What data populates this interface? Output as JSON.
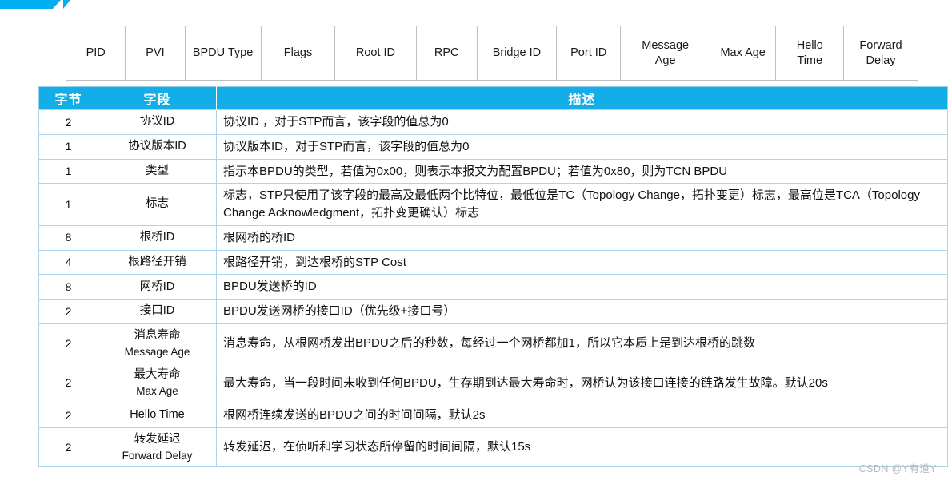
{
  "banner": {
    "accent_color": "#00AEEF"
  },
  "format_table": {
    "name": "BPDU frame format strip",
    "cells": [
      "PID",
      "PVI",
      "BPDU Type",
      "Flags",
      "Root ID",
      "RPC",
      "Bridge ID",
      "Port ID",
      "Message\nAge",
      "Max Age",
      "Hello\nTime",
      "Forward\nDelay"
    ]
  },
  "field_table": {
    "header_color": "#13AEE8",
    "accent_color": "#ED7D6E",
    "columns": [
      "字节",
      "字段",
      "描述"
    ],
    "rows": [
      {
        "bytes": "2",
        "field": "协议ID",
        "field_cn": "",
        "field_en": "",
        "accent": false,
        "desc": "协议ID ，对于STP而言，该字段的值总为0"
      },
      {
        "bytes": "1",
        "field": "协议版本ID",
        "field_cn": "",
        "field_en": "",
        "accent": false,
        "desc": "协议版本ID，对于STP而言，该字段的值总为0"
      },
      {
        "bytes": "1",
        "field": "类型",
        "field_cn": "",
        "field_en": "",
        "accent": false,
        "desc": "指示本BPDU的类型，若值为0x00，则表示本报文为配置BPDU；若值为0x80，则为TCN BPDU"
      },
      {
        "bytes": "1",
        "field": "标志",
        "field_cn": "",
        "field_en": "",
        "accent": false,
        "desc": "标志，STP只使用了该字段的最高及最低两个比特位，最低位是TC（Topology Change，拓扑变更）标志，最高位是TCA（Topology Change Acknowledgment，拓扑变更确认）标志"
      },
      {
        "bytes": "8",
        "field": "根桥ID",
        "field_cn": "",
        "field_en": "",
        "accent": true,
        "desc": "根网桥的桥ID"
      },
      {
        "bytes": "4",
        "field": "根路径开销",
        "field_cn": "",
        "field_en": "",
        "accent": true,
        "desc": "根路径开销，到达根桥的STP Cost"
      },
      {
        "bytes": "8",
        "field": "网桥ID",
        "field_cn": "",
        "field_en": "",
        "accent": true,
        "desc": "BPDU发送桥的ID"
      },
      {
        "bytes": "2",
        "field": "接口ID",
        "field_cn": "",
        "field_en": "",
        "accent": true,
        "desc": "BPDU发送网桥的接口ID（优先级+接口号）"
      },
      {
        "bytes": "2",
        "field": "",
        "field_cn": "消息寿命",
        "field_en": "Message Age",
        "accent": false,
        "desc": "消息寿命，从根网桥发出BPDU之后的秒数，每经过一个网桥都加1，所以它本质上是到达根桥的跳数"
      },
      {
        "bytes": "2",
        "field": "",
        "field_cn": "最大寿命",
        "field_en": "Max Age",
        "accent": false,
        "desc": "最大寿命，当一段时间未收到任何BPDU，生存期到达最大寿命时，网桥认为该接口连接的链路发生故障。默认20s"
      },
      {
        "bytes": "2",
        "field": "Hello Time",
        "field_cn": "",
        "field_en": "",
        "accent": false,
        "desc": "根网桥连续发送的BPDU之间的时间间隔，默认2s"
      },
      {
        "bytes": "2",
        "field": "",
        "field_cn": "转发延迟",
        "field_en": "Forward Delay",
        "accent": false,
        "desc": "转发延迟，在侦听和学习状态所停留的时间间隔，默认15s"
      }
    ]
  },
  "watermark": {
    "text": "CSDN @Y有道Y"
  }
}
